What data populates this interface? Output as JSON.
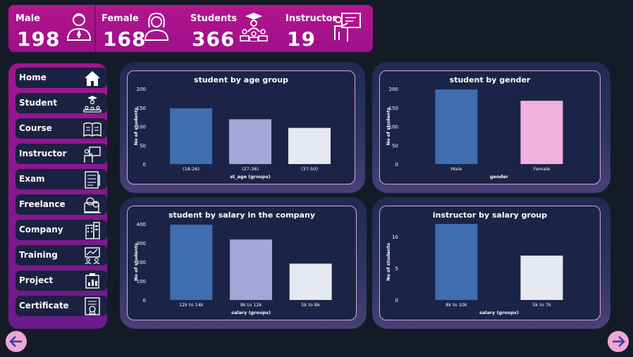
{
  "kpis": [
    {
      "label": "Male",
      "value": "198",
      "icon": "male-user-icon"
    },
    {
      "label": "Female",
      "value": "168",
      "icon": "female-user-icon"
    },
    {
      "label": "Students",
      "value": "366",
      "icon": "students-group-icon"
    },
    {
      "label": "Instructor",
      "value": "19",
      "icon": "instructor-board-icon"
    }
  ],
  "sidebar": {
    "items": [
      {
        "label": "Home",
        "icon": "home-icon"
      },
      {
        "label": "Student",
        "icon": "student-icon"
      },
      {
        "label": "Course",
        "icon": "book-icon"
      },
      {
        "label": "Instructor",
        "icon": "instructor-icon"
      },
      {
        "label": "Exam",
        "icon": "exam-icon"
      },
      {
        "label": "Freelance",
        "icon": "freelance-icon"
      },
      {
        "label": "Company",
        "icon": "building-icon"
      },
      {
        "label": "Training",
        "icon": "training-icon"
      },
      {
        "label": "Project",
        "icon": "project-icon"
      },
      {
        "label": "Certificate",
        "icon": "certificate-icon"
      }
    ]
  },
  "colors": {
    "banner": "#a0118b",
    "bar_blue": "#3e6db0",
    "bar_lavender": "#a4a6d8",
    "bar_white": "#e6e8f2",
    "bar_pink": "#f1b0dc",
    "arrow": "#efa7d5"
  },
  "chart_data": [
    {
      "type": "bar",
      "title": "student by age group",
      "xlabel": "st_age (groups)",
      "ylabel": "No of students",
      "categories": [
        "(18-26)",
        "(27-36)",
        "(37-50)"
      ],
      "values": [
        148,
        119,
        96
      ],
      "yticks": [
        0,
        50,
        100,
        150,
        200
      ],
      "ylim": [
        0,
        200
      ],
      "colors": [
        "#3e6db0",
        "#a4a6d8",
        "#e6e8f2"
      ]
    },
    {
      "type": "bar",
      "title": "student by gender",
      "xlabel": "gender",
      "ylabel": "No of students",
      "categories": [
        "Male",
        "Female"
      ],
      "values": [
        198,
        168
      ],
      "yticks": [
        0,
        50,
        100,
        150,
        200
      ],
      "ylim": [
        0,
        200
      ],
      "colors": [
        "#3e6db0",
        "#f1b0dc"
      ]
    },
    {
      "type": "bar",
      "title": "student by salary in the company",
      "xlabel": "salary (groups)",
      "ylabel": "No of students",
      "categories": [
        "12k to 14k",
        "9k to 12k",
        "5k to 8k"
      ],
      "values": [
        396,
        318,
        191
      ],
      "yticks": [
        0,
        100,
        200,
        300,
        400
      ],
      "ylim": [
        0,
        400
      ],
      "colors": [
        "#3e6db0",
        "#a4a6d8",
        "#e6e8f2"
      ]
    },
    {
      "type": "bar",
      "title": "instructor by salary group",
      "xlabel": "salary (groups)",
      "ylabel": "No of students",
      "categories": [
        "8k to 10k",
        "5k to 7k"
      ],
      "values": [
        12,
        7
      ],
      "yticks": [
        0,
        5,
        10
      ],
      "ylim": [
        0,
        12
      ],
      "colors": [
        "#3e6db0",
        "#e6e8f2"
      ]
    }
  ],
  "nav": {
    "back_icon": "arrow-left-icon",
    "forward_icon": "arrow-right-icon"
  }
}
